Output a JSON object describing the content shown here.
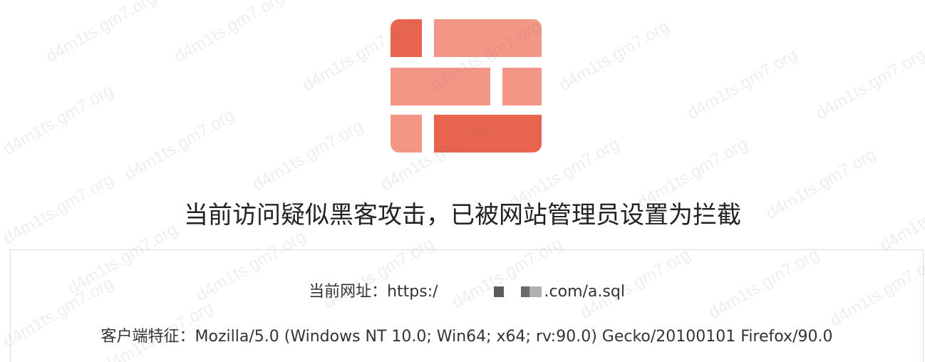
{
  "heading": "当前访问疑似黑客攻击，已被网站管理员设置为拦截",
  "info": {
    "url_label": "当前网址：",
    "url_prefix": "https:/",
    "url_suffix": ".com/a.sql",
    "ua_label": "客户端特征：",
    "ua_value": "Mozilla/5.0 (Windows NT 10.0; Win64; x64; rv:90.0) Gecko/20100101 Firefox/90.0"
  },
  "watermark_text": "d4m1ts.gm7.org",
  "logo": {
    "icon": "brick-wall-firewall-icon",
    "color_dark": "#e8644e",
    "color_light": "#f49686"
  }
}
